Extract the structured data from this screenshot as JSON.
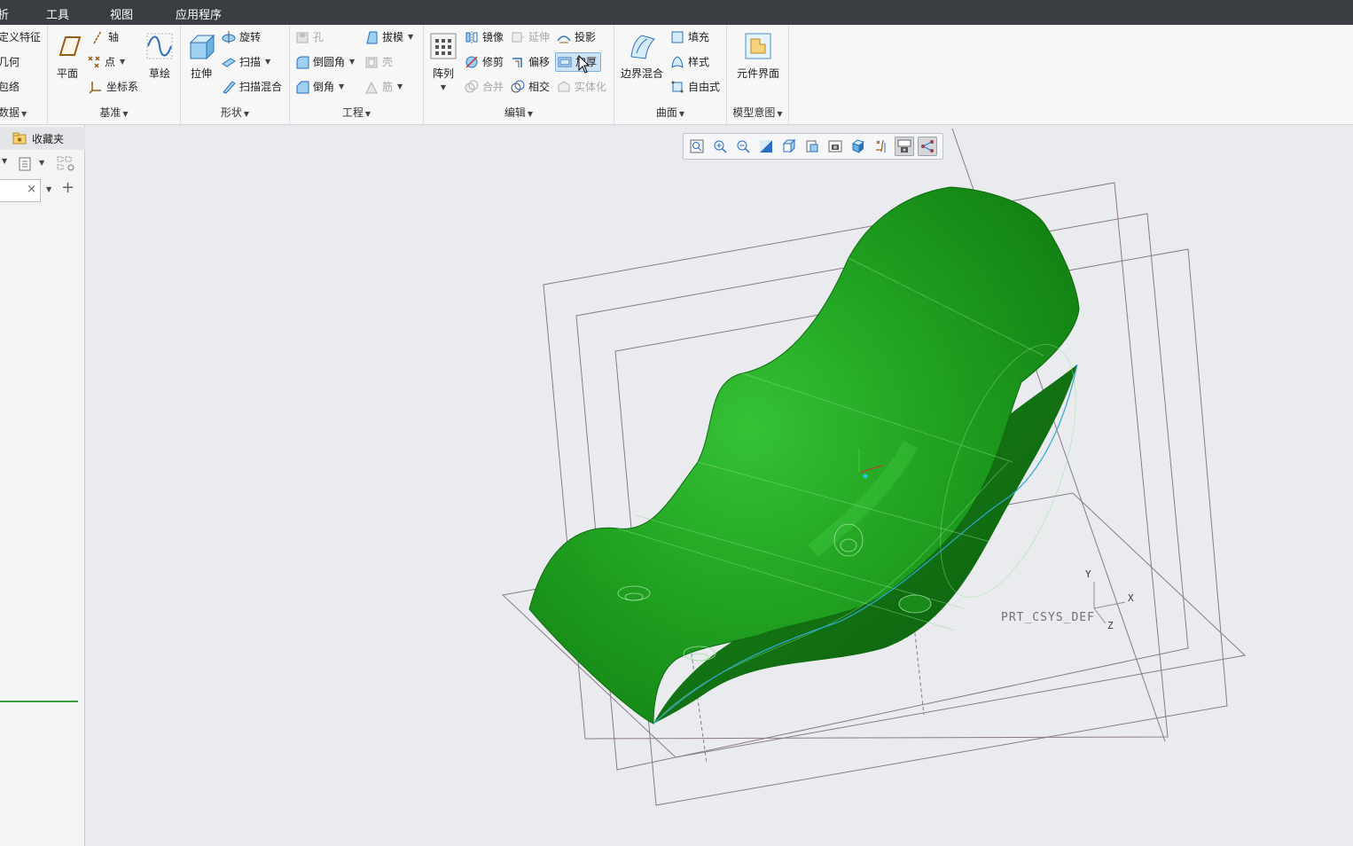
{
  "menu": {
    "items": [
      "析",
      "工具",
      "视图",
      "应用程序"
    ]
  },
  "ribbon": {
    "datum_left": {
      "items": [
        "定义特征",
        "几何",
        "包络"
      ],
      "group_label": "数据"
    },
    "datum": {
      "plane_label": "平面",
      "axis_label": "轴",
      "point_label": "点",
      "csys_label": "坐标系",
      "sketch_label": "草绘",
      "group_label": "基准"
    },
    "shapes": {
      "extrude_label": "拉伸",
      "revolve_label": "旋转",
      "sweep_label": "扫描",
      "swept_blend_label": "扫描混合",
      "group_label": "形状"
    },
    "engineering": {
      "hole_label": "孔",
      "draft_label": "拔模",
      "round_label": "倒圆角",
      "shell_label": "壳",
      "chamfer_label": "倒角",
      "rib_label": "筋",
      "group_label": "工程"
    },
    "editing": {
      "pattern_label": "阵列",
      "mirror_label": "镜像",
      "extend_label": "延伸",
      "project_label": "投影",
      "trim_label": "修剪",
      "offset_label": "偏移",
      "thicken_label": "加厚",
      "merge_label": "合并",
      "intersect_label": "相交",
      "solidify_label": "实体化",
      "group_label": "编辑"
    },
    "surfaces": {
      "boundary_blend_label": "边界混合",
      "fill_label": "填充",
      "style_label": "样式",
      "freestyle_label": "自由式",
      "group_label": "曲面"
    },
    "model_intent": {
      "component_interface_label": "元件界面",
      "group_label": "模型意图"
    }
  },
  "left_panel": {
    "favorites_label": "收藏夹"
  },
  "viewport": {
    "csys_label": "PRT_CSYS_DEF",
    "axis_x": "X",
    "axis_y": "Y",
    "axis_z": "Z"
  },
  "colors": {
    "menubar": "#3a3d42",
    "part_green": "#1f9a1f",
    "datum_plane": "#8a7a86",
    "highlight": "#cfe3f7"
  }
}
